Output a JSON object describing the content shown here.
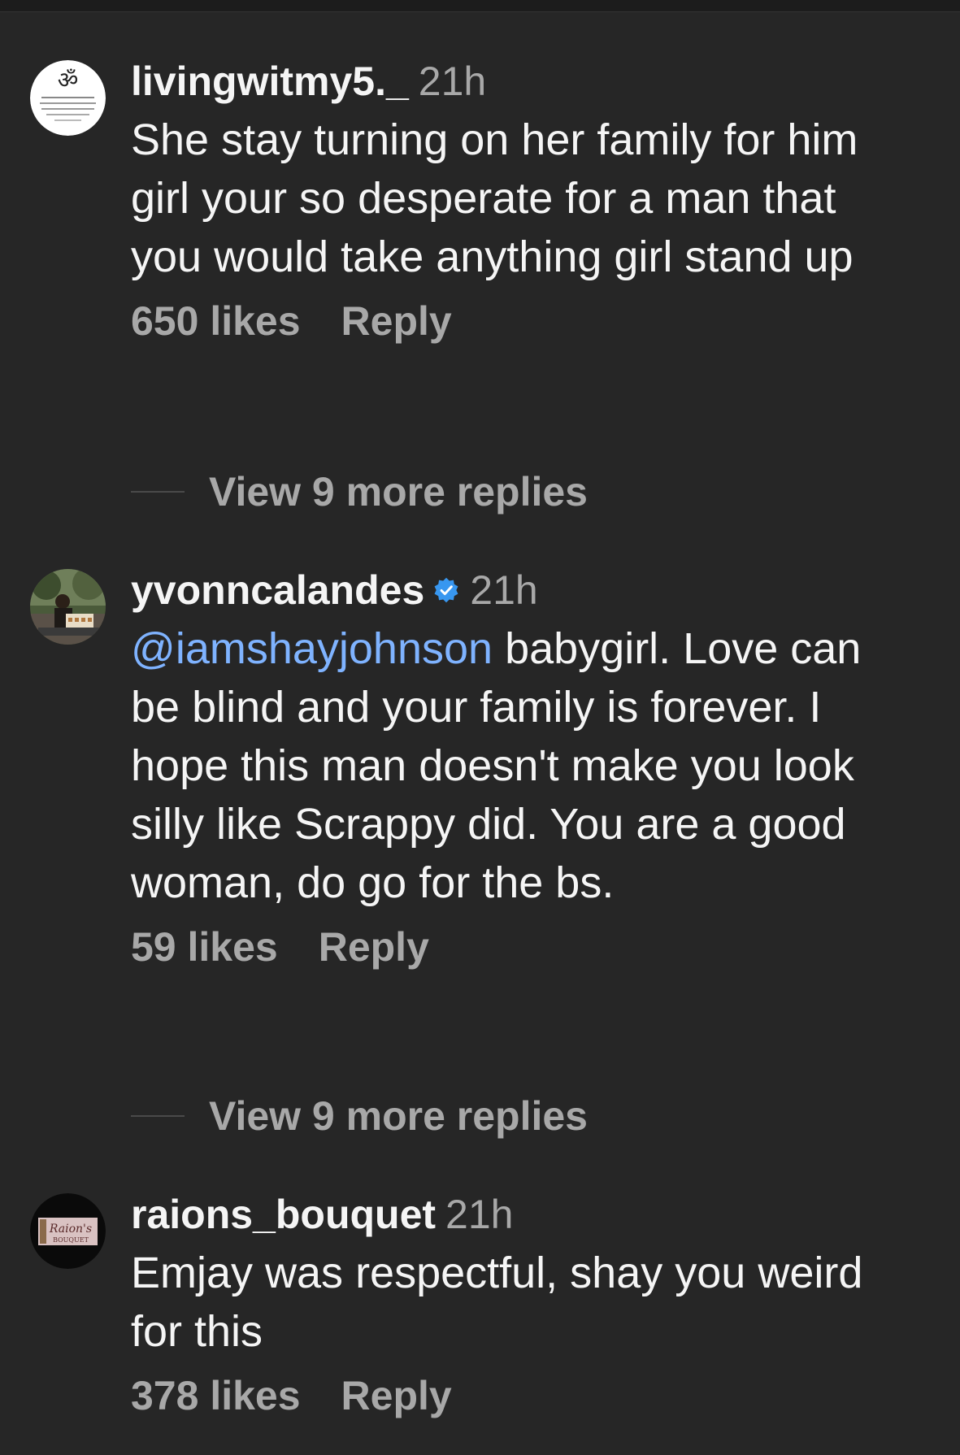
{
  "comments": [
    {
      "username": "livingwitmy5._",
      "verified": false,
      "time": "21h",
      "text": "She stay turning on her family for him girl your so desperate for a man that you would take anything girl stand up",
      "likes": "650 likes",
      "reply": "Reply",
      "view_replies": "View 9 more replies"
    },
    {
      "username": "yvonncalandes",
      "verified": true,
      "time": "21h",
      "mention": "@iamshayjohnson",
      "text": " babygirl. Love can be blind and your family is forever. I hope this man doesn't make you look silly like Scrappy did. You are a good woman, do go for the bs.",
      "likes": "59 likes",
      "reply": "Reply",
      "view_replies": "View 9 more replies"
    },
    {
      "username": "raions_bouquet",
      "verified": false,
      "time": "21h",
      "text": "Emjay was respectful, shay you weird for this",
      "likes": "378 likes",
      "reply": "Reply",
      "avatar_logo_text": "Raion's BOUQUET"
    }
  ],
  "colors": {
    "background": "#262626",
    "primary_text": "#f5f5f5",
    "secondary_text": "#a8a8a8",
    "mention": "#7fb3ff",
    "verified_badge": "#3897f0"
  }
}
